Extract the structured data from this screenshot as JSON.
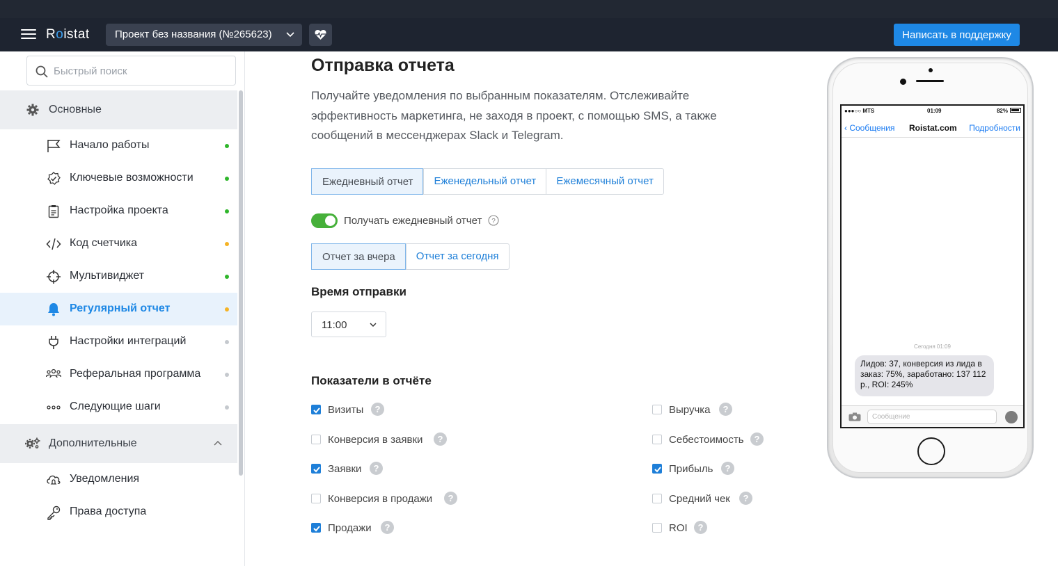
{
  "app": {
    "logo": "Roistat",
    "project": "Проект без названия (№265623)",
    "support_button": "Написать в поддержку"
  },
  "sidebar": {
    "search_placeholder": "Быстрый поиск",
    "sections": [
      {
        "label": "Основные",
        "icon": "gear-icon",
        "items": [
          {
            "label": "Начало работы",
            "icon": "flag-icon",
            "status": "#2fb62b"
          },
          {
            "label": "Ключевые возможности",
            "icon": "check-circle-icon",
            "status": "#2fb62b"
          },
          {
            "label": "Настройка проекта",
            "icon": "clipboard-icon",
            "status": "#2fb62b"
          },
          {
            "label": "Код счетчика",
            "icon": "code-icon",
            "status": "#f5b325"
          },
          {
            "label": "Мультивиджет",
            "icon": "crosshair-icon",
            "status": "#2fb62b"
          },
          {
            "label": "Регулярный отчет",
            "icon": "bell-icon",
            "status": "#f5b325",
            "active": true
          },
          {
            "label": "Настройки интеграций",
            "icon": "plug-icon",
            "status": "#c5c9ce"
          },
          {
            "label": "Реферальная программа",
            "icon": "people-icon",
            "status": "#c5c9ce"
          },
          {
            "label": "Следующие шаги",
            "icon": "dots-icon",
            "status": "#c5c9ce"
          }
        ]
      },
      {
        "label": "Дополнительные",
        "icon": "gears-icon",
        "items": [
          {
            "label": "Уведомления",
            "icon": "cloud-bell-icon"
          },
          {
            "label": "Права доступа",
            "icon": "key-icon"
          }
        ]
      }
    ]
  },
  "main": {
    "title": "Отправка отчета",
    "description": "Получайте уведомления по выбранным показателям. Отслеживайте эффективность маркетинга, не заходя в проект, с помощью SMS, а также сообщений в мессенджерах Slack и Telegram.",
    "report_tabs": [
      "Ежедневный отчет",
      "Еженедельный отчет",
      "Ежемесячный отчет"
    ],
    "toggle_label": "Получать ежедневный отчет",
    "toggle_on": true,
    "period_tabs": [
      "Отчет за вчера",
      "Отчет за сегодня"
    ],
    "time_heading": "Время отправки",
    "time_value": "11:00",
    "metrics_heading": "Показатели в отчёте",
    "metrics_left": [
      {
        "label": "Визиты",
        "checked": true
      },
      {
        "label": "Конверсия в заявки",
        "checked": false
      },
      {
        "label": "Заявки",
        "checked": true
      },
      {
        "label": "Конверсия в продажи",
        "checked": false
      },
      {
        "label": "Продажи",
        "checked": true
      }
    ],
    "metrics_right": [
      {
        "label": "Выручка",
        "checked": false
      },
      {
        "label": "Себестоимость",
        "checked": false
      },
      {
        "label": "Прибыль",
        "checked": true
      },
      {
        "label": "Средний чек",
        "checked": false
      },
      {
        "label": "ROI",
        "checked": false
      }
    ]
  },
  "phone": {
    "carrier": "●●●○○ MTS",
    "time": "01:09",
    "battery": "82%",
    "back_label": "Сообщения",
    "contact": "Roistat.com",
    "details_label": "Подробности",
    "timestamp": "Сегодня 01:09",
    "message": "Лидов: 37, конверсия из лида в заказ: 75%, заработано: 137 112 р., ROI: 245%",
    "input_placeholder": "Сообщение"
  }
}
